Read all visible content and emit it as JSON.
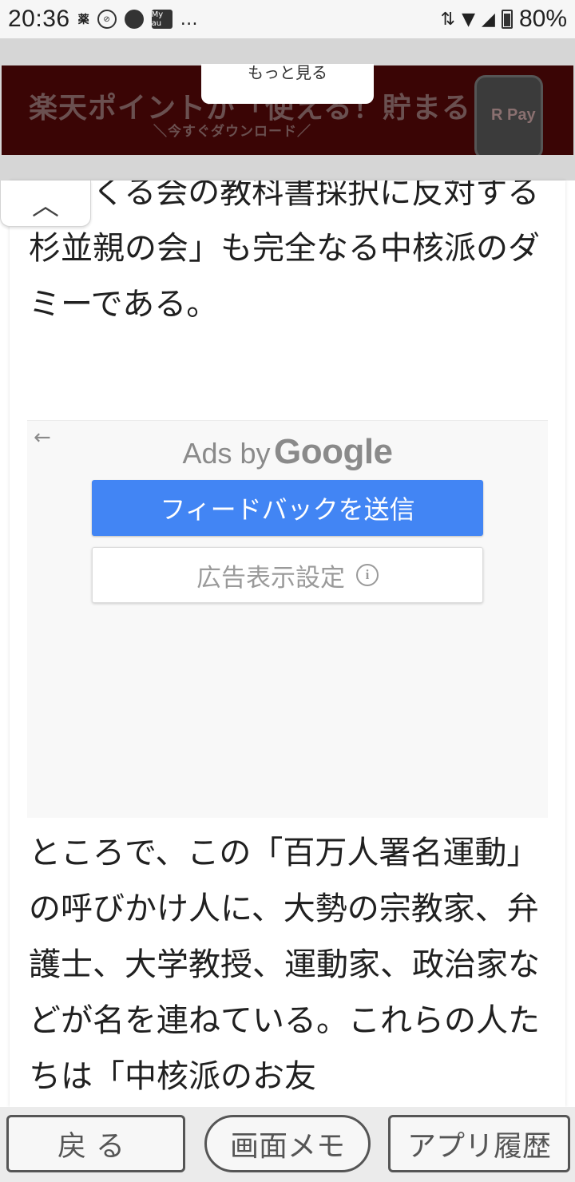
{
  "status_bar": {
    "time": "20:36",
    "badge_text": "薬",
    "icons": [
      "block-icon",
      "weather-icon",
      "myau-icon"
    ],
    "myau_label": "My au",
    "more": "…",
    "battery": "80%"
  },
  "banner_ad": {
    "headline": "楽天ポイントが「使える！貯まる！",
    "subline": "＼今すぐダウンロード／",
    "phone_label": "R Pay",
    "more_label": "もっと見る",
    "background_color": "#3a0505"
  },
  "collapse_tab": {
    "icon": "chevron-up-icon",
    "glyph": "︿"
  },
  "article": {
    "paragraph_top": "「つくる会の教科書採択に反対する杉並親の会」も完全なる中核派のダミーである。",
    "paragraph_bottom": "ところで、この「百万人署名運動」の呼びかけ人に、大勢の宗教家、弁護士、大学教授、運動家、政治家などが名を連ねている。これらの人たちは「中核派のお友"
  },
  "google_ad": {
    "back_glyph": "←",
    "ads_by": "Ads by",
    "google": "Google",
    "feedback_button": "フィードバックを送信",
    "ad_settings_button": "広告表示設定",
    "info_glyph": "i",
    "accent_color": "#4285f4"
  },
  "bottom_nav": {
    "back": "戻る",
    "memo": "画面メモ",
    "history": "アプリ履歴"
  }
}
